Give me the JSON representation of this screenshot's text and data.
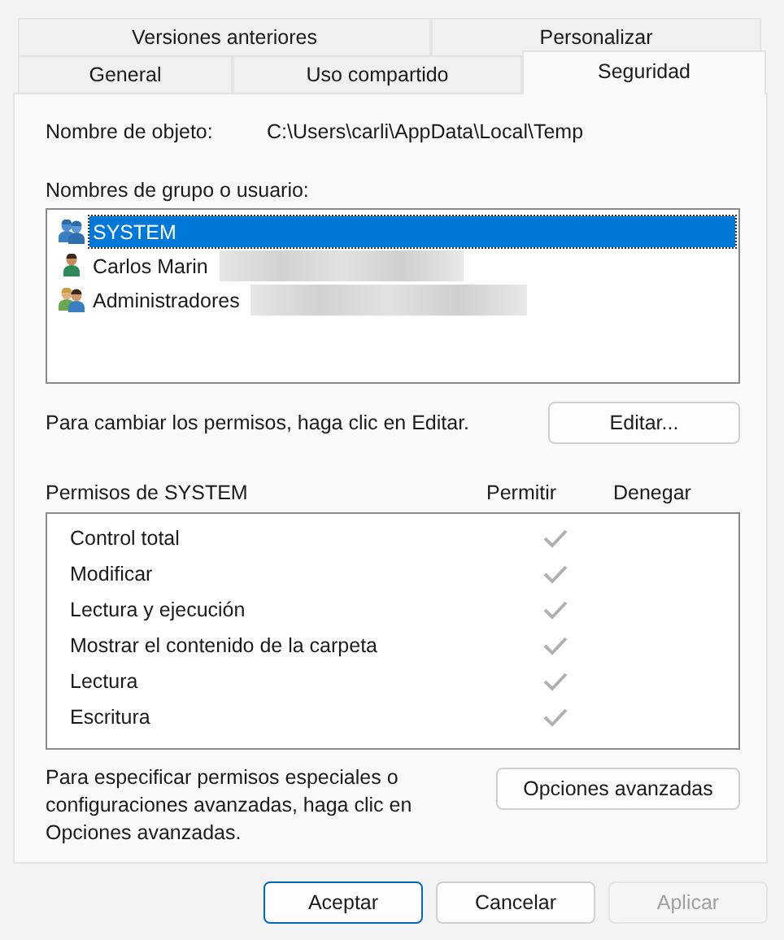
{
  "tabs": [
    [
      {
        "label": "Versiones anteriores",
        "selected": false
      },
      {
        "label": "Personalizar",
        "selected": false
      }
    ],
    [
      {
        "label": "General",
        "selected": false
      },
      {
        "label": "Uso compartido",
        "selected": false
      },
      {
        "label": "Seguridad",
        "selected": true
      }
    ]
  ],
  "object_name": {
    "label": "Nombre de objeto:",
    "value": "C:\\Users\\carli\\AppData\\Local\\Temp"
  },
  "users": {
    "label": "Nombres de grupo o usuario:",
    "items": [
      {
        "name": "SYSTEM",
        "kind": "system-group",
        "selected": true,
        "redacted": false
      },
      {
        "name": "Carlos Marin",
        "kind": "user",
        "selected": false,
        "redacted": true
      },
      {
        "name": "Administradores",
        "kind": "admin-group",
        "selected": false,
        "redacted": true
      }
    ]
  },
  "edit_hint": "Para cambiar los permisos, haga clic en Editar.",
  "edit_button": "Editar...",
  "permissions": {
    "title": "Permisos de SYSTEM",
    "allow_header": "Permitir",
    "deny_header": "Denegar",
    "rows": [
      {
        "name": "Control total",
        "allow": true
      },
      {
        "name": "Modificar",
        "allow": true
      },
      {
        "name": "Lectura y ejecución",
        "allow": true
      },
      {
        "name": "Mostrar el contenido de la carpeta",
        "allow": true
      },
      {
        "name": "Lectura",
        "allow": true
      },
      {
        "name": "Escritura",
        "allow": true
      }
    ]
  },
  "advanced_hint": "Para especificar permisos especiales o configuraciones avanzadas, haga clic en Opciones avanzadas.",
  "advanced_button": "Opciones avanzadas",
  "buttons": [
    {
      "label": "Aceptar",
      "kind": "default",
      "disabled": false
    },
    {
      "label": "Cancelar",
      "kind": "normal",
      "disabled": false
    },
    {
      "label": "Aplicar",
      "kind": "normal",
      "disabled": true
    }
  ]
}
